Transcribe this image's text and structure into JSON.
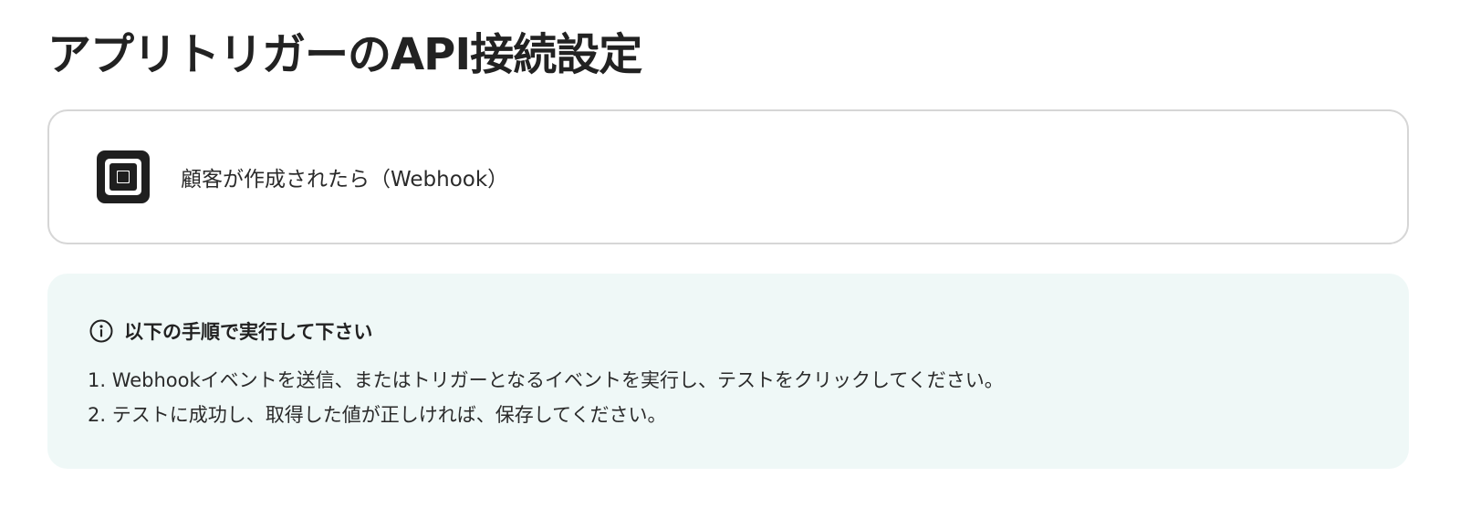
{
  "page": {
    "title": "アプリトリガーのAPI接続設定"
  },
  "trigger": {
    "icon": "square-app-icon",
    "label": "顧客が作成されたら（Webhook）"
  },
  "info": {
    "icon": "info-circle-icon",
    "title": "以下の手順で実行して下さい",
    "steps": [
      "1. Webhookイベントを送信、またはトリガーとなるイベントを実行し、テストをクリックしてください。",
      "2. テストに成功し、取得した値が正しければ、保存してください。"
    ]
  },
  "colors": {
    "panel_bg": "#eff8f7",
    "card_border": "#d6d6d6",
    "text": "#222222"
  }
}
